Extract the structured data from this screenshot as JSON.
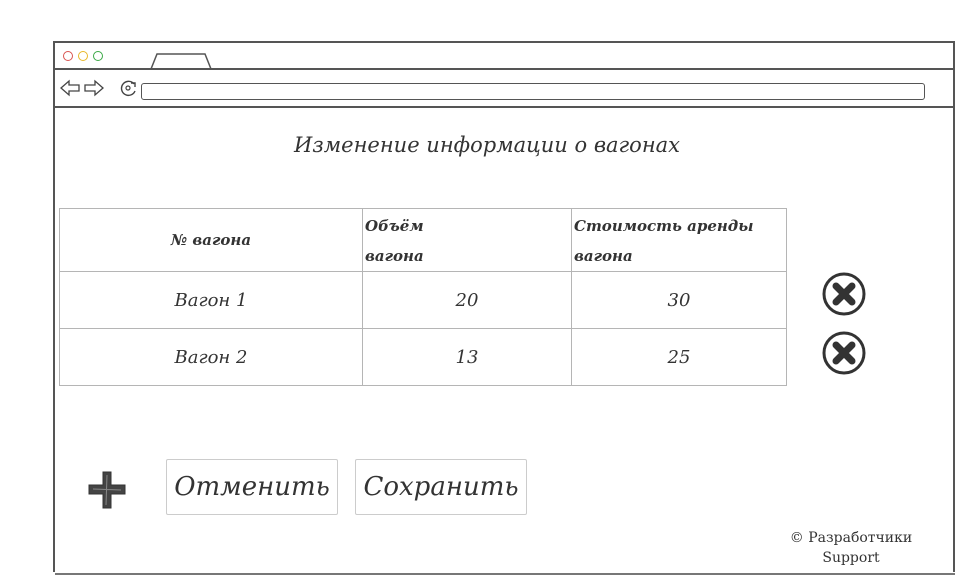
{
  "page": {
    "title": "Изменение информации о вагонах"
  },
  "table": {
    "headers": {
      "number": "№ вагона",
      "volume_line1": "Объём",
      "volume_line2": "вагона",
      "cost_line1": "Стоимость аренды",
      "cost_line2": "вагона"
    },
    "rows": [
      {
        "name": "Вагон 1",
        "volume": "20",
        "cost": "30"
      },
      {
        "name": "Вагон 2",
        "volume": "13",
        "cost": "25"
      }
    ]
  },
  "buttons": {
    "cancel_label": "Отменить",
    "save_label": "Сохранить"
  },
  "footer": {
    "line1": "© Разработчики",
    "line2": "Support"
  },
  "icons": {
    "delete": "delete-circle-icon",
    "add": "plus-icon"
  },
  "colors": {
    "stroke": "#333333",
    "border": "#b5b5b5",
    "window_dot_red": "#d9534f",
    "window_dot_yellow": "#e8b82a",
    "window_dot_green": "#3aa845"
  }
}
